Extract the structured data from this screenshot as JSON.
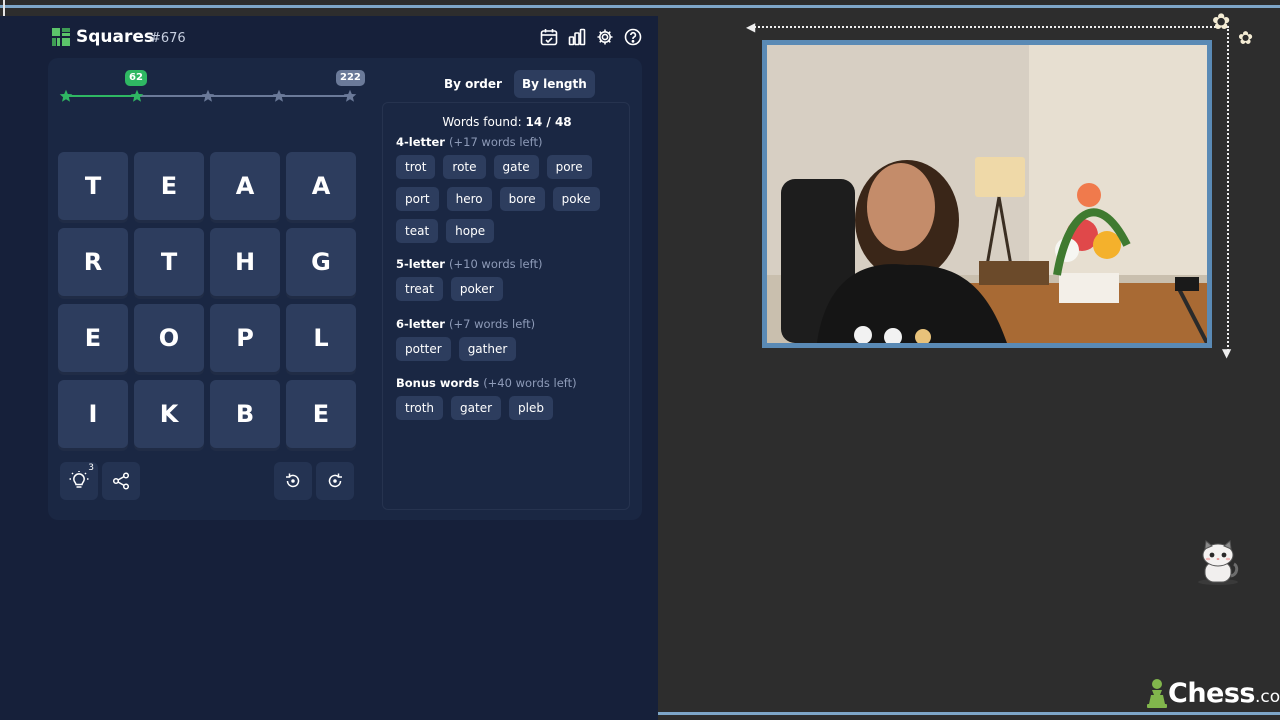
{
  "app": {
    "title": "Squares",
    "puzzle_number": "#676"
  },
  "header_icons": [
    "calendar-icon",
    "stats-icon",
    "settings-icon",
    "help-icon"
  ],
  "progress": {
    "current_score": "62",
    "max_score": "222",
    "stars_total": 5,
    "stars_reached": 2,
    "fill_fraction": 0.25,
    "colors": {
      "done": "#2fb863",
      "pending": "#6b7a99",
      "max_badge": "#6b7a99"
    }
  },
  "grid": {
    "rows": [
      [
        "T",
        "E",
        "A",
        "A"
      ],
      [
        "R",
        "T",
        "H",
        "G"
      ],
      [
        "E",
        "O",
        "P",
        "L"
      ],
      [
        "I",
        "K",
        "B",
        "E"
      ]
    ]
  },
  "tools": {
    "hint_count": "3"
  },
  "tabs": {
    "by_order": "By order",
    "by_length": "By length",
    "active": "by_length"
  },
  "words": {
    "found_label": "Words found:",
    "found_count": "14 / 48",
    "sections": [
      {
        "title": "4-letter",
        "remaining": "(+17 words left)",
        "words": [
          "trot",
          "rote",
          "gate",
          "pore",
          "port",
          "hero",
          "bore",
          "poke",
          "teat",
          "hope"
        ]
      },
      {
        "title": "5-letter",
        "remaining": "(+10 words left)",
        "words": [
          "treat",
          "poker"
        ]
      },
      {
        "title": "6-letter",
        "remaining": "(+7 words left)",
        "words": [
          "potter",
          "gather"
        ]
      },
      {
        "title": "Bonus words",
        "remaining": "(+40 words left)",
        "words": [
          "troth",
          "gater",
          "pleb"
        ]
      }
    ]
  },
  "brand": {
    "chess_word": "Chess",
    "chess_tld": ".com"
  },
  "colors": {
    "game_bg": "#16203a",
    "tile": "#2d3d5e",
    "accent_green": "#2fb863",
    "frame_blue": "#5a8ab5"
  }
}
